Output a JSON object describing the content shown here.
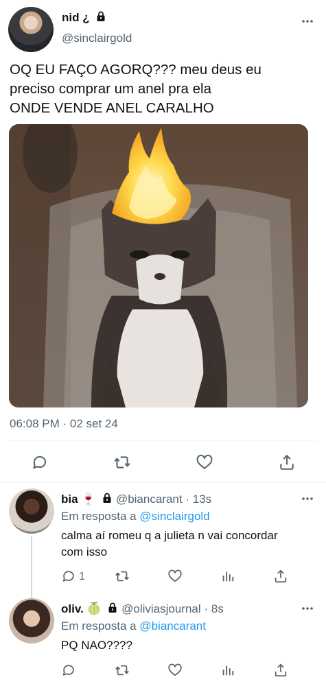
{
  "main_tweet": {
    "author_name": "nid ¿",
    "author_handle": "@sinclairgold",
    "text_lines": [
      "OQ EU FAÇO AGORQ??? meu deus eu",
      "preciso comprar um anel pra ela",
      "ONDE VENDE ANEL CARALHO"
    ],
    "timestamp": "06:08 PM · 02 set 24"
  },
  "replies": [
    {
      "author_name": "bia",
      "emoji": "🍷",
      "author_handle": "@biancarant",
      "time": "13s",
      "reply_prefix": "Em resposta a",
      "reply_to": "@sinclairgold",
      "body_lines": [
        "calma aí romeu q a julieta n vai concordar",
        "com isso"
      ],
      "reply_count": "1"
    },
    {
      "author_name": "oliv.",
      "emoji": "🍈",
      "author_handle": "@oliviasjournal",
      "time": "8s",
      "reply_prefix": "Em resposta a",
      "reply_to": "@biancarant",
      "body_lines": [
        "PQ NAO????"
      ],
      "reply_count": ""
    }
  ],
  "icons": {
    "lock": "lock-icon",
    "more": "more-icon",
    "reply": "reply-icon",
    "retweet": "retweet-icon",
    "like": "like-icon",
    "share": "share-icon",
    "views": "views-icon"
  },
  "colors": {
    "text": "#0f1419",
    "secondary": "#536471",
    "accent": "#1d9bf0"
  }
}
